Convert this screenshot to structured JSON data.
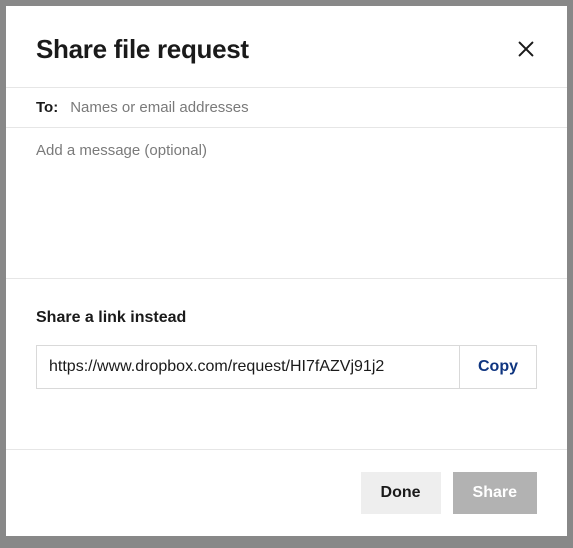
{
  "header": {
    "title": "Share file request"
  },
  "to": {
    "label": "To:",
    "placeholder": "Names or email addresses",
    "value": ""
  },
  "message": {
    "placeholder": "Add a message (optional)",
    "value": ""
  },
  "link": {
    "heading": "Share a link instead",
    "url": "https://www.dropbox.com/request/HI7fAZVj91j2",
    "copy_label": "Copy"
  },
  "footer": {
    "done_label": "Done",
    "share_label": "Share"
  }
}
